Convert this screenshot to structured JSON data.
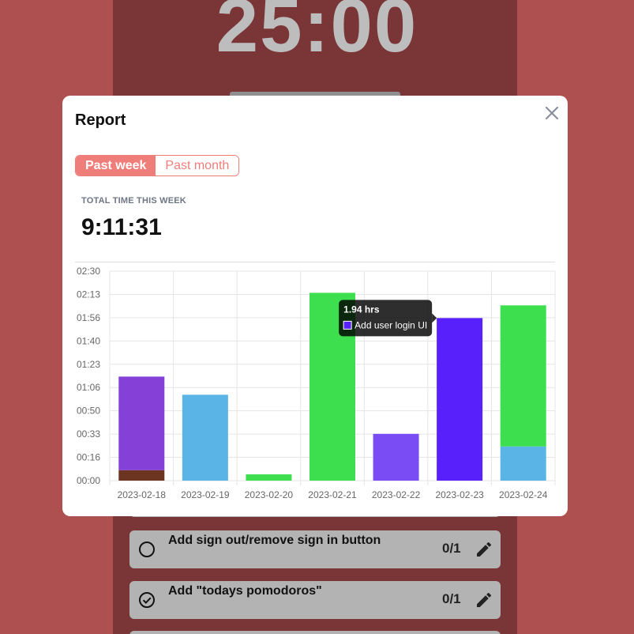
{
  "background": {
    "timer_text": "25:00",
    "tasks": [
      {
        "title": "Add sign out/remove sign in button",
        "count": "0/1",
        "done": false
      },
      {
        "title": "Add \"todays pomodoros\"",
        "count": "0/1",
        "done": true
      }
    ]
  },
  "modal": {
    "title": "Report",
    "tabs": [
      {
        "label": "Past week",
        "active": true
      },
      {
        "label": "Past month",
        "active": false
      }
    ],
    "total_label": "TOTAL TIME THIS WEEK",
    "total_value": "9:11:31"
  },
  "colors": {
    "accent": "#ef7e7a",
    "purple": "#8540d7",
    "brown": "#6b3522",
    "blue": "#5ab4e5",
    "green": "#3ddf4f",
    "violet": "#7a4cf4",
    "indigo": "#5821fb"
  },
  "chart_data": {
    "type": "bar",
    "stacked": true,
    "categories": [
      "2023-02-18",
      "2023-02-19",
      "2023-02-20",
      "2023-02-21",
      "2023-02-22",
      "2023-02-23",
      "2023-02-24"
    ],
    "y_unit": "minutes",
    "y_ticks": [
      "00:00",
      "00:16",
      "00:33",
      "00:50",
      "01:06",
      "01:23",
      "01:40",
      "01:56",
      "02:13",
      "02:30"
    ],
    "ylim": [
      0,
      150
    ],
    "grid": true,
    "segments": [
      {
        "category": "2023-02-18",
        "value": 7.5,
        "color": "#6b3522"
      },
      {
        "category": "2023-02-18",
        "value": 67,
        "color": "#8540d7"
      },
      {
        "category": "2023-02-19",
        "value": 61.5,
        "color": "#5ab4e5"
      },
      {
        "category": "2023-02-20",
        "value": 4.5,
        "color": "#3ddf4f"
      },
      {
        "category": "2023-02-21",
        "value": 134.5,
        "color": "#3ddf4f"
      },
      {
        "category": "2023-02-22",
        "value": 33.5,
        "color": "#7a4cf4"
      },
      {
        "category": "2023-02-23",
        "value": 116.4,
        "color": "#5821fb"
      },
      {
        "category": "2023-02-24",
        "value": 24.5,
        "color": "#5ab4e5"
      },
      {
        "category": "2023-02-24",
        "value": 101,
        "color": "#3ddf4f"
      }
    ],
    "tooltip": {
      "category": "2023-02-23",
      "title": "1.94 hrs",
      "label": "Add user login UI",
      "color": "#5821fb"
    }
  }
}
